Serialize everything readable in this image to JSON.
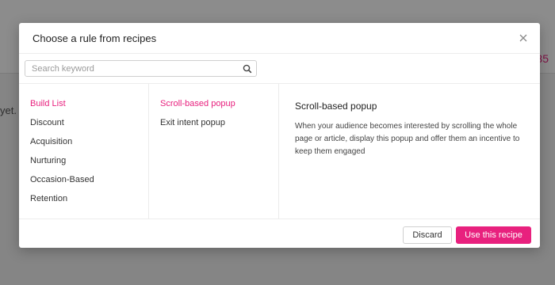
{
  "background": {
    "count_text": "35",
    "partial_text": "yet."
  },
  "modal": {
    "title": "Choose a rule from recipes",
    "search": {
      "placeholder": "Search keyword",
      "value": ""
    },
    "categories": [
      {
        "label": "Build List",
        "active": true
      },
      {
        "label": "Discount",
        "active": false
      },
      {
        "label": "Acquisition",
        "active": false
      },
      {
        "label": "Nurturing",
        "active": false
      },
      {
        "label": "Occasion-Based",
        "active": false
      },
      {
        "label": "Retention",
        "active": false
      }
    ],
    "recipes": [
      {
        "label": "Scroll-based popup",
        "active": true
      },
      {
        "label": "Exit intent popup",
        "active": false
      }
    ],
    "detail": {
      "title": "Scroll-based popup",
      "description": "When your audience becomes interested by scrolling the whole page or article, display this popup and offer them an incentive to keep them engaged"
    },
    "footer": {
      "discard_label": "Discard",
      "use_label": "Use this recipe"
    }
  },
  "colors": {
    "accent": "#e8217e",
    "overlay": "rgba(0,0,0,0.45)"
  },
  "icons": {
    "close": "close-icon",
    "search": "search-icon"
  }
}
